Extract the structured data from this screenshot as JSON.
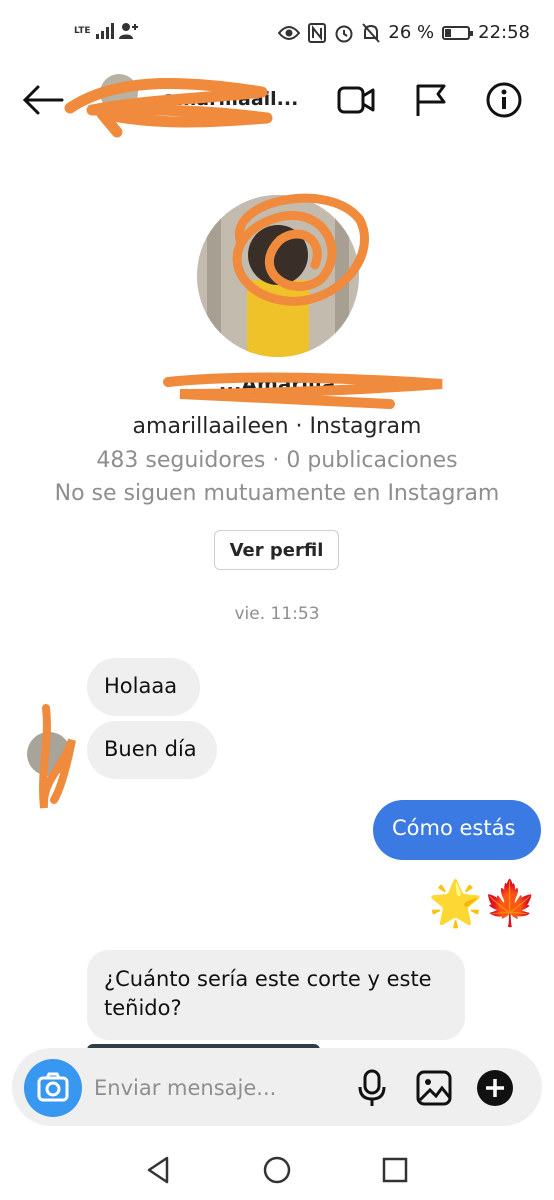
{
  "status_bar": {
    "network": "LTE",
    "battery_text": "26 %",
    "battery_level": 0.26,
    "time": "22:58"
  },
  "header": {
    "contact_name": "...amarillaail...",
    "icons": [
      "back-arrow-icon",
      "video-call-icon",
      "flag-icon",
      "info-icon"
    ]
  },
  "profile": {
    "name": "...Amarilla",
    "handle": "amarillaaileen · Instagram",
    "stats": "483 seguidores · 0 publicaciones",
    "mutual": "No se siguen mutuamente en Instagram",
    "view_profile_label": "Ver perfil"
  },
  "thread": {
    "timestamp": "vie. 11:53",
    "messages": [
      {
        "from": "them",
        "text": "Holaaa"
      },
      {
        "from": "them",
        "text": "Buen día"
      },
      {
        "from": "me",
        "text": "Cómo estás"
      },
      {
        "from": "me",
        "text": "🌟🍁"
      },
      {
        "from": "them",
        "text": "¿Cuánto sería este corte y este teñido?"
      }
    ]
  },
  "composer": {
    "placeholder": "Enviar mensaje...",
    "icons": [
      "camera-icon",
      "microphone-icon",
      "gallery-icon",
      "add-icon"
    ]
  },
  "nav": {
    "icons": [
      "back-triangle-icon",
      "home-circle-icon",
      "recents-square-icon"
    ]
  },
  "colors": {
    "outgoing_bubble": "#3a7ae2",
    "incoming_bubble": "#efefef",
    "camera_button": "#3897f0",
    "scribble": "#f08a3c"
  }
}
